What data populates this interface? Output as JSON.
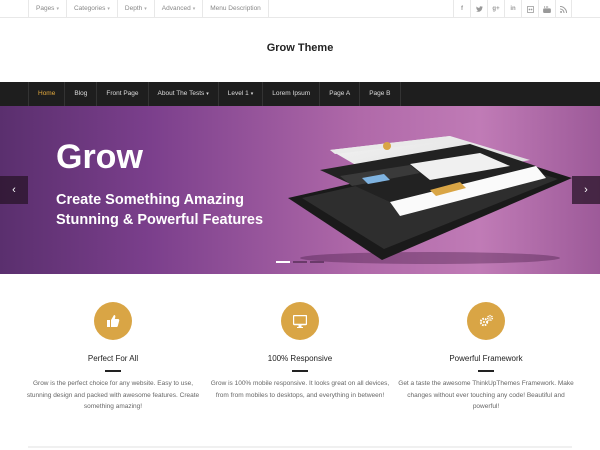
{
  "topbar": {
    "menu": [
      {
        "label": "Pages",
        "caret": true
      },
      {
        "label": "Categories",
        "caret": true
      },
      {
        "label": "Depth",
        "caret": true
      },
      {
        "label": "Advanced",
        "caret": true
      },
      {
        "label": "Menu Description",
        "caret": false
      }
    ],
    "social": [
      {
        "icon": "facebook-icon",
        "glyph": "f"
      },
      {
        "icon": "twitter-icon",
        "glyph": "t"
      },
      {
        "icon": "google-plus-icon",
        "glyph": "g+"
      },
      {
        "icon": "linkedin-icon",
        "glyph": "in"
      },
      {
        "icon": "flickr-icon",
        "glyph": "▣"
      },
      {
        "icon": "youtube-icon",
        "glyph": "▶"
      },
      {
        "icon": "rss-icon",
        "glyph": ")"
      }
    ]
  },
  "header": {
    "site_title": "Grow Theme"
  },
  "nav": {
    "items": [
      {
        "label": "Home",
        "active": true,
        "caret": false
      },
      {
        "label": "Blog",
        "active": false,
        "caret": false
      },
      {
        "label": "Front Page",
        "active": false,
        "caret": false
      },
      {
        "label": "About The Tests",
        "active": false,
        "caret": true
      },
      {
        "label": "Level 1",
        "active": false,
        "caret": true
      },
      {
        "label": "Lorem Ipsum",
        "active": false,
        "caret": false
      },
      {
        "label": "Page A",
        "active": false,
        "caret": false
      },
      {
        "label": "Page B",
        "active": false,
        "caret": false
      }
    ]
  },
  "slider": {
    "heading": "Grow",
    "subheading_line1": "Create Something Amazing",
    "subheading_line2": "Stunning & Powerful Features",
    "prev": "‹",
    "next": "›",
    "slide_count": 3,
    "active_slide": 1
  },
  "features": [
    {
      "title": "Perfect For All",
      "desc": "Grow is the perfect choice for any website. Easy to use, stunning design and packed with awesome features. Create something amazing!",
      "icon": "thumbs-up-icon"
    },
    {
      "title": "100% Responsive",
      "desc": "Grow is 100% mobile responsive. It looks great on all devices, from from mobiles to desktops, and everything in between!",
      "icon": "monitor-icon"
    },
    {
      "title": "Powerful Framework",
      "desc": "Get a taste the awesome ThinkUpThemes Framework. Make changes without ever touching any code! Beautiful and powerful!",
      "icon": "gears-icon"
    }
  ],
  "colors": {
    "accent": "#d9a545",
    "nav_bg": "#1e1e1e",
    "nav_active": "#e3a93d"
  }
}
